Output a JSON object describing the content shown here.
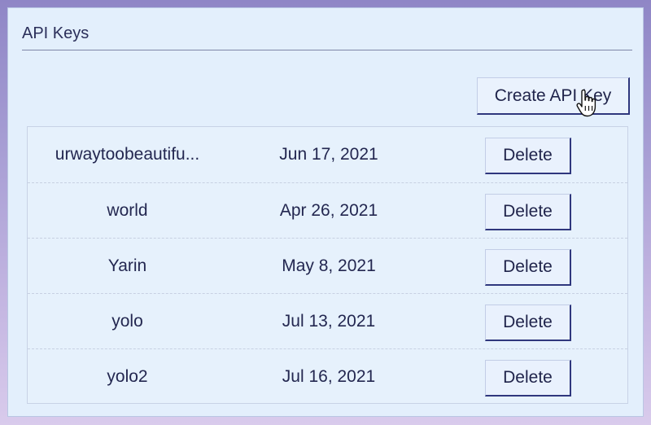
{
  "panel": {
    "title": "API Keys"
  },
  "toolbar": {
    "create_label": "Create API Key"
  },
  "keys": [
    {
      "name": "urwaytoobeautifu...",
      "date": "Jun 17, 2021",
      "action": "Delete"
    },
    {
      "name": "world",
      "date": "Apr 26, 2021",
      "action": "Delete"
    },
    {
      "name": "Yarin",
      "date": "May 8, 2021",
      "action": "Delete"
    },
    {
      "name": "yolo",
      "date": "Jul 13, 2021",
      "action": "Delete"
    },
    {
      "name": "yolo2",
      "date": "Jul 16, 2021",
      "action": "Delete"
    }
  ],
  "colors": {
    "accent_border": "#2f377d",
    "panel_bg": "#e3effc",
    "text": "#26294f"
  }
}
